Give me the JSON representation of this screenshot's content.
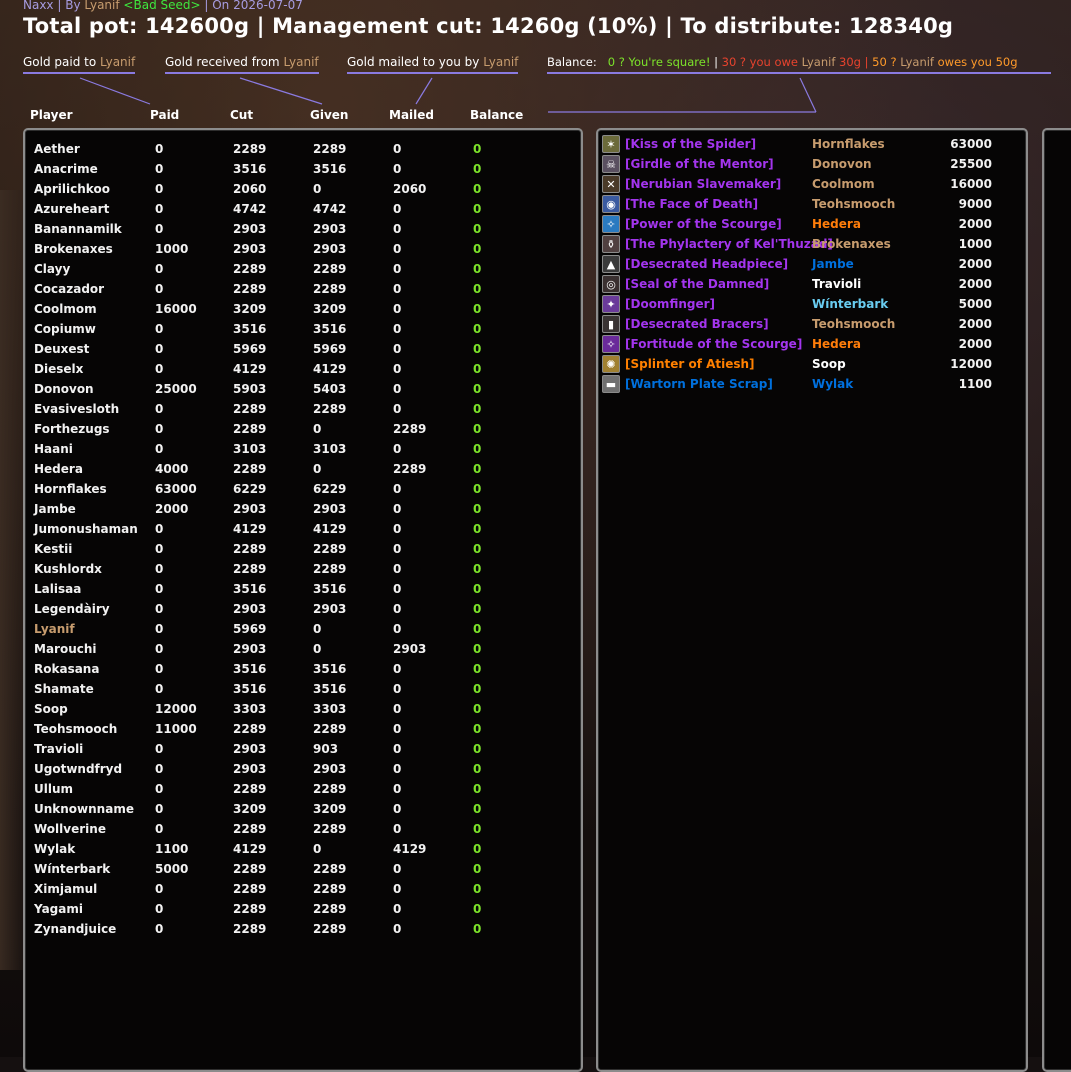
{
  "header": {
    "raid": "Naxx",
    "by_label": "By",
    "author": "Lyanif",
    "guild": "<Bad Seed>",
    "on_label": "On",
    "date": "2026-07-07",
    "title": "Total pot: 142600g | Management cut: 14260g (10%) | To distribute: 128340g"
  },
  "legend": {
    "paid_prefix": "Gold paid to ",
    "received_prefix": "Gold received from ",
    "mailed_prefix": "Gold mailed to you by ",
    "name": "Lyanif",
    "balance_label": "Balance:",
    "balance_square": "0 ? You're square!",
    "sep": "|",
    "owe_prefix": "30 ? you owe ",
    "owe_amount": " 30g",
    "owed_prefix": "50 ? ",
    "owed_mid": " owes you 50g"
  },
  "columns": {
    "player": "Player",
    "paid": "Paid",
    "cut": "Cut",
    "given": "Given",
    "mailed": "Mailed",
    "balance": "Balance"
  },
  "players": [
    {
      "name": "Aether",
      "paid": "0",
      "cut": "2289",
      "given": "2289",
      "mailed": "0",
      "balance": "0"
    },
    {
      "name": "Anacrime",
      "paid": "0",
      "cut": "3516",
      "given": "3516",
      "mailed": "0",
      "balance": "0"
    },
    {
      "name": "Aprilichkoo",
      "paid": "0",
      "cut": "2060",
      "given": "0",
      "mailed": "2060",
      "balance": "0"
    },
    {
      "name": "Azureheart",
      "paid": "0",
      "cut": "4742",
      "given": "4742",
      "mailed": "0",
      "balance": "0"
    },
    {
      "name": "Banannamilk",
      "paid": "0",
      "cut": "2903",
      "given": "2903",
      "mailed": "0",
      "balance": "0"
    },
    {
      "name": "Brokenaxes",
      "paid": "1000",
      "cut": "2903",
      "given": "2903",
      "mailed": "0",
      "balance": "0"
    },
    {
      "name": "Clayy",
      "paid": "0",
      "cut": "2289",
      "given": "2289",
      "mailed": "0",
      "balance": "0"
    },
    {
      "name": "Cocazador",
      "paid": "0",
      "cut": "2289",
      "given": "2289",
      "mailed": "0",
      "balance": "0"
    },
    {
      "name": "Coolmom",
      "paid": "16000",
      "cut": "3209",
      "given": "3209",
      "mailed": "0",
      "balance": "0"
    },
    {
      "name": "Copiumw",
      "paid": "0",
      "cut": "3516",
      "given": "3516",
      "mailed": "0",
      "balance": "0"
    },
    {
      "name": "Deuxest",
      "paid": "0",
      "cut": "5969",
      "given": "5969",
      "mailed": "0",
      "balance": "0"
    },
    {
      "name": "Dieselx",
      "paid": "0",
      "cut": "4129",
      "given": "4129",
      "mailed": "0",
      "balance": "0"
    },
    {
      "name": "Donovon",
      "paid": "25000",
      "cut": "5903",
      "given": "5403",
      "mailed": "0",
      "balance": "0"
    },
    {
      "name": "Evasivesloth",
      "paid": "0",
      "cut": "2289",
      "given": "2289",
      "mailed": "0",
      "balance": "0"
    },
    {
      "name": "Forthezugs",
      "paid": "0",
      "cut": "2289",
      "given": "0",
      "mailed": "2289",
      "balance": "0"
    },
    {
      "name": "Haani",
      "paid": "0",
      "cut": "3103",
      "given": "3103",
      "mailed": "0",
      "balance": "0"
    },
    {
      "name": "Hedera",
      "paid": "4000",
      "cut": "2289",
      "given": "0",
      "mailed": "2289",
      "balance": "0"
    },
    {
      "name": "Hornflakes",
      "paid": "63000",
      "cut": "6229",
      "given": "6229",
      "mailed": "0",
      "balance": "0"
    },
    {
      "name": "Jambe",
      "paid": "2000",
      "cut": "2903",
      "given": "2903",
      "mailed": "0",
      "balance": "0"
    },
    {
      "name": "Jumonushaman",
      "paid": "0",
      "cut": "4129",
      "given": "4129",
      "mailed": "0",
      "balance": "0"
    },
    {
      "name": "Kestii",
      "paid": "0",
      "cut": "2289",
      "given": "2289",
      "mailed": "0",
      "balance": "0"
    },
    {
      "name": "Kushlordx",
      "paid": "0",
      "cut": "2289",
      "given": "2289",
      "mailed": "0",
      "balance": "0"
    },
    {
      "name": "Lalisaa",
      "paid": "0",
      "cut": "3516",
      "given": "3516",
      "mailed": "0",
      "balance": "0"
    },
    {
      "name": "Legendàiry",
      "paid": "0",
      "cut": "2903",
      "given": "2903",
      "mailed": "0",
      "balance": "0"
    },
    {
      "name": "Lyanif",
      "paid": "0",
      "cut": "5969",
      "given": "0",
      "mailed": "0",
      "balance": "0",
      "self": true
    },
    {
      "name": "Marouchi",
      "paid": "0",
      "cut": "2903",
      "given": "0",
      "mailed": "2903",
      "balance": "0"
    },
    {
      "name": "Rokasana",
      "paid": "0",
      "cut": "3516",
      "given": "3516",
      "mailed": "0",
      "balance": "0"
    },
    {
      "name": "Shamate",
      "paid": "0",
      "cut": "3516",
      "given": "3516",
      "mailed": "0",
      "balance": "0"
    },
    {
      "name": "Soop",
      "paid": "12000",
      "cut": "3303",
      "given": "3303",
      "mailed": "0",
      "balance": "0"
    },
    {
      "name": "Teohsmooch",
      "paid": "11000",
      "cut": "2289",
      "given": "2289",
      "mailed": "0",
      "balance": "0"
    },
    {
      "name": "Travioli",
      "paid": "0",
      "cut": "2903",
      "given": "903",
      "mailed": "0",
      "balance": "0"
    },
    {
      "name": "Ugotwndfryd",
      "paid": "0",
      "cut": "2903",
      "given": "2903",
      "mailed": "0",
      "balance": "0"
    },
    {
      "name": "Ullum",
      "paid": "0",
      "cut": "2289",
      "given": "2289",
      "mailed": "0",
      "balance": "0"
    },
    {
      "name": "Unknownname",
      "paid": "0",
      "cut": "3209",
      "given": "3209",
      "mailed": "0",
      "balance": "0"
    },
    {
      "name": "Wollverine",
      "paid": "0",
      "cut": "2289",
      "given": "2289",
      "mailed": "0",
      "balance": "0"
    },
    {
      "name": "Wylak",
      "paid": "1100",
      "cut": "4129",
      "given": "0",
      "mailed": "4129",
      "balance": "0"
    },
    {
      "name": "Wínterbark",
      "paid": "5000",
      "cut": "2289",
      "given": "2289",
      "mailed": "0",
      "balance": "0"
    },
    {
      "name": "Ximjamul",
      "paid": "0",
      "cut": "2289",
      "given": "2289",
      "mailed": "0",
      "balance": "0"
    },
    {
      "name": "Yagami",
      "paid": "0",
      "cut": "2289",
      "given": "2289",
      "mailed": "0",
      "balance": "0"
    },
    {
      "name": "Zynandjuice",
      "paid": "0",
      "cut": "2289",
      "given": "2289",
      "mailed": "0",
      "balance": "0"
    }
  ],
  "items": [
    {
      "item": "[Kiss of the Spider]",
      "winner": "Hornflakes",
      "amount": "63000",
      "item_color": "#a335ee",
      "winner_color": "#c79c6e",
      "icon_color": "#6b6a3a",
      "icon": "spider-icon"
    },
    {
      "item": "[Girdle of the Mentor]",
      "winner": "Donovon",
      "amount": "25500",
      "item_color": "#a335ee",
      "winner_color": "#c79c6e",
      "icon_color": "#5a5060",
      "icon": "girdle-icon"
    },
    {
      "item": "[Nerubian Slavemaker]",
      "winner": "Coolmom",
      "amount": "16000",
      "item_color": "#a335ee",
      "winner_color": "#c79c6e",
      "icon_color": "#4a3a28",
      "icon": "crossbow-icon"
    },
    {
      "item": "[The Face of Death]",
      "winner": "Teohsmooch",
      "amount": "9000",
      "item_color": "#a335ee",
      "winner_color": "#c79c6e",
      "icon_color": "#3a5aa0",
      "icon": "shield-icon"
    },
    {
      "item": "[Power of the Scourge]",
      "winner": "Hedera",
      "amount": "2000",
      "item_color": "#a335ee",
      "winner_color": "#ff7d0a",
      "icon_color": "#2a7ac0",
      "icon": "enchant-icon"
    },
    {
      "item": "[The Phylactery of Kel'Thuzad]",
      "winner": "Brokenaxes",
      "amount": "1000",
      "item_color": "#a335ee",
      "winner_color": "#c79c6e",
      "icon_color": "#504040",
      "icon": "phylactery-icon"
    },
    {
      "item": "[Desecrated Headpiece]",
      "winner": "Jambe",
      "amount": "2000",
      "item_color": "#a335ee",
      "winner_color": "#0070de",
      "icon_color": "#3a3a3a",
      "icon": "helm-icon"
    },
    {
      "item": "[Seal of the Damned]",
      "winner": "Travioli",
      "amount": "2000",
      "item_color": "#a335ee",
      "winner_color": "#ffffff",
      "icon_color": "#3a3030",
      "icon": "ring-icon"
    },
    {
      "item": "[Doomfinger]",
      "winner": "Wínterbark",
      "amount": "5000",
      "item_color": "#a335ee",
      "winner_color": "#69ccf0",
      "icon_color": "#6a3a9a",
      "icon": "wand-icon"
    },
    {
      "item": "[Desecrated Bracers]",
      "winner": "Teohsmooch",
      "amount": "2000",
      "item_color": "#a335ee",
      "winner_color": "#c79c6e",
      "icon_color": "#3a3434",
      "icon": "bracers-icon"
    },
    {
      "item": "[Fortitude of the Scourge]",
      "winner": "Hedera",
      "amount": "2000",
      "item_color": "#a335ee",
      "winner_color": "#ff7d0a",
      "icon_color": "#6a2a9a",
      "icon": "enchant-icon"
    },
    {
      "item": "[Splinter of Atiesh]",
      "winner": "Soop",
      "amount": "12000",
      "item_color": "#ff8000",
      "winner_color": "#ffffff",
      "icon_color": "#a08030",
      "icon": "splinter-icon"
    },
    {
      "item": "[Wartorn Plate Scrap]",
      "winner": "Wylak",
      "amount": "1100",
      "item_color": "#0070dd",
      "winner_color": "#0070de",
      "icon_color": "#707070",
      "icon": "scrap-icon"
    }
  ],
  "colors": {
    "balance_zero": "#7ce32a",
    "owe": "#e8432e",
    "owed": "#ff9a2a",
    "accent_line": "#8a7ae0"
  }
}
